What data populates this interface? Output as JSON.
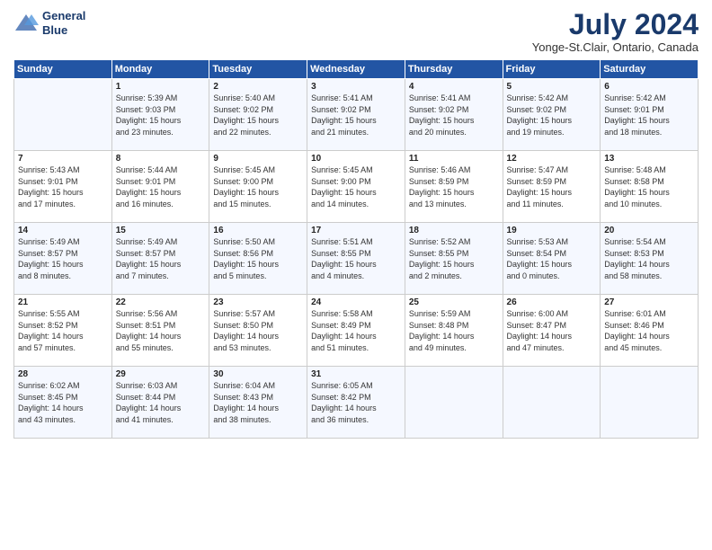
{
  "logo": {
    "line1": "General",
    "line2": "Blue"
  },
  "title": "July 2024",
  "location": "Yonge-St.Clair, Ontario, Canada",
  "days_header": [
    "Sunday",
    "Monday",
    "Tuesday",
    "Wednesday",
    "Thursday",
    "Friday",
    "Saturday"
  ],
  "weeks": [
    [
      {
        "num": "",
        "info": ""
      },
      {
        "num": "1",
        "info": "Sunrise: 5:39 AM\nSunset: 9:03 PM\nDaylight: 15 hours\nand 23 minutes."
      },
      {
        "num": "2",
        "info": "Sunrise: 5:40 AM\nSunset: 9:02 PM\nDaylight: 15 hours\nand 22 minutes."
      },
      {
        "num": "3",
        "info": "Sunrise: 5:41 AM\nSunset: 9:02 PM\nDaylight: 15 hours\nand 21 minutes."
      },
      {
        "num": "4",
        "info": "Sunrise: 5:41 AM\nSunset: 9:02 PM\nDaylight: 15 hours\nand 20 minutes."
      },
      {
        "num": "5",
        "info": "Sunrise: 5:42 AM\nSunset: 9:02 PM\nDaylight: 15 hours\nand 19 minutes."
      },
      {
        "num": "6",
        "info": "Sunrise: 5:42 AM\nSunset: 9:01 PM\nDaylight: 15 hours\nand 18 minutes."
      }
    ],
    [
      {
        "num": "7",
        "info": "Sunrise: 5:43 AM\nSunset: 9:01 PM\nDaylight: 15 hours\nand 17 minutes."
      },
      {
        "num": "8",
        "info": "Sunrise: 5:44 AM\nSunset: 9:01 PM\nDaylight: 15 hours\nand 16 minutes."
      },
      {
        "num": "9",
        "info": "Sunrise: 5:45 AM\nSunset: 9:00 PM\nDaylight: 15 hours\nand 15 minutes."
      },
      {
        "num": "10",
        "info": "Sunrise: 5:45 AM\nSunset: 9:00 PM\nDaylight: 15 hours\nand 14 minutes."
      },
      {
        "num": "11",
        "info": "Sunrise: 5:46 AM\nSunset: 8:59 PM\nDaylight: 15 hours\nand 13 minutes."
      },
      {
        "num": "12",
        "info": "Sunrise: 5:47 AM\nSunset: 8:59 PM\nDaylight: 15 hours\nand 11 minutes."
      },
      {
        "num": "13",
        "info": "Sunrise: 5:48 AM\nSunset: 8:58 PM\nDaylight: 15 hours\nand 10 minutes."
      }
    ],
    [
      {
        "num": "14",
        "info": "Sunrise: 5:49 AM\nSunset: 8:57 PM\nDaylight: 15 hours\nand 8 minutes."
      },
      {
        "num": "15",
        "info": "Sunrise: 5:49 AM\nSunset: 8:57 PM\nDaylight: 15 hours\nand 7 minutes."
      },
      {
        "num": "16",
        "info": "Sunrise: 5:50 AM\nSunset: 8:56 PM\nDaylight: 15 hours\nand 5 minutes."
      },
      {
        "num": "17",
        "info": "Sunrise: 5:51 AM\nSunset: 8:55 PM\nDaylight: 15 hours\nand 4 minutes."
      },
      {
        "num": "18",
        "info": "Sunrise: 5:52 AM\nSunset: 8:55 PM\nDaylight: 15 hours\nand 2 minutes."
      },
      {
        "num": "19",
        "info": "Sunrise: 5:53 AM\nSunset: 8:54 PM\nDaylight: 15 hours\nand 0 minutes."
      },
      {
        "num": "20",
        "info": "Sunrise: 5:54 AM\nSunset: 8:53 PM\nDaylight: 14 hours\nand 58 minutes."
      }
    ],
    [
      {
        "num": "21",
        "info": "Sunrise: 5:55 AM\nSunset: 8:52 PM\nDaylight: 14 hours\nand 57 minutes."
      },
      {
        "num": "22",
        "info": "Sunrise: 5:56 AM\nSunset: 8:51 PM\nDaylight: 14 hours\nand 55 minutes."
      },
      {
        "num": "23",
        "info": "Sunrise: 5:57 AM\nSunset: 8:50 PM\nDaylight: 14 hours\nand 53 minutes."
      },
      {
        "num": "24",
        "info": "Sunrise: 5:58 AM\nSunset: 8:49 PM\nDaylight: 14 hours\nand 51 minutes."
      },
      {
        "num": "25",
        "info": "Sunrise: 5:59 AM\nSunset: 8:48 PM\nDaylight: 14 hours\nand 49 minutes."
      },
      {
        "num": "26",
        "info": "Sunrise: 6:00 AM\nSunset: 8:47 PM\nDaylight: 14 hours\nand 47 minutes."
      },
      {
        "num": "27",
        "info": "Sunrise: 6:01 AM\nSunset: 8:46 PM\nDaylight: 14 hours\nand 45 minutes."
      }
    ],
    [
      {
        "num": "28",
        "info": "Sunrise: 6:02 AM\nSunset: 8:45 PM\nDaylight: 14 hours\nand 43 minutes."
      },
      {
        "num": "29",
        "info": "Sunrise: 6:03 AM\nSunset: 8:44 PM\nDaylight: 14 hours\nand 41 minutes."
      },
      {
        "num": "30",
        "info": "Sunrise: 6:04 AM\nSunset: 8:43 PM\nDaylight: 14 hours\nand 38 minutes."
      },
      {
        "num": "31",
        "info": "Sunrise: 6:05 AM\nSunset: 8:42 PM\nDaylight: 14 hours\nand 36 minutes."
      },
      {
        "num": "",
        "info": ""
      },
      {
        "num": "",
        "info": ""
      },
      {
        "num": "",
        "info": ""
      }
    ]
  ]
}
